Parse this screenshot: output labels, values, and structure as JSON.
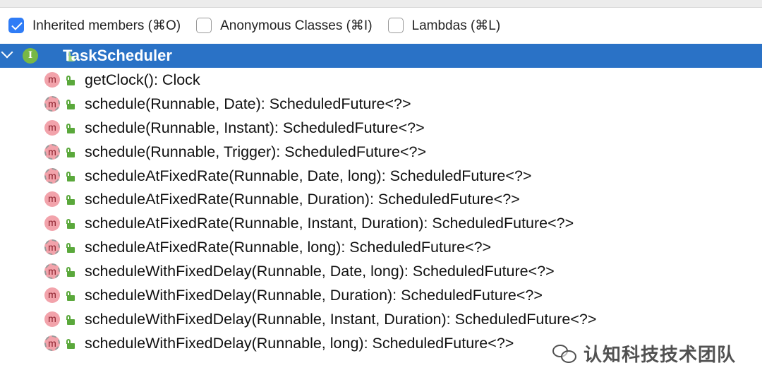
{
  "filters": [
    {
      "label": "Inherited members (⌘O)",
      "checked": true
    },
    {
      "label": "Anonymous Classes (⌘I)",
      "checked": false
    },
    {
      "label": "Lambdas (⌘L)",
      "checked": false
    }
  ],
  "root": {
    "label": "TaskScheduler",
    "icon_letter": "I",
    "icon": "interface-icon",
    "expanded": true,
    "selected": true
  },
  "members": [
    {
      "label": "getClock(): Clock",
      "abstract": false
    },
    {
      "label": "schedule(Runnable, Date): ScheduledFuture<?>",
      "abstract": true
    },
    {
      "label": "schedule(Runnable, Instant): ScheduledFuture<?>",
      "abstract": false
    },
    {
      "label": "schedule(Runnable, Trigger): ScheduledFuture<?>",
      "abstract": true
    },
    {
      "label": "scheduleAtFixedRate(Runnable, Date, long): ScheduledFuture<?>",
      "abstract": true
    },
    {
      "label": "scheduleAtFixedRate(Runnable, Duration): ScheduledFuture<?>",
      "abstract": false
    },
    {
      "label": "scheduleAtFixedRate(Runnable, Instant, Duration): ScheduledFuture<?>",
      "abstract": false
    },
    {
      "label": "scheduleAtFixedRate(Runnable, long): ScheduledFuture<?>",
      "abstract": true
    },
    {
      "label": "scheduleWithFixedDelay(Runnable, Date, long): ScheduledFuture<?>",
      "abstract": true
    },
    {
      "label": "scheduleWithFixedDelay(Runnable, Duration): ScheduledFuture<?>",
      "abstract": false
    },
    {
      "label": "scheduleWithFixedDelay(Runnable, Instant, Duration): ScheduledFuture<?>",
      "abstract": false
    },
    {
      "label": "scheduleWithFixedDelay(Runnable, long): ScheduledFuture<?>",
      "abstract": true
    }
  ],
  "method_icon_letter": "m",
  "watermark": {
    "text": "认知科技技术团队"
  },
  "colors": {
    "selection": "#2a72c6",
    "checkbox_checked": "#2f7cf6",
    "method_icon": "#f2a3ab",
    "interface_icon": "#78b845",
    "lock": "#5aa83b"
  }
}
